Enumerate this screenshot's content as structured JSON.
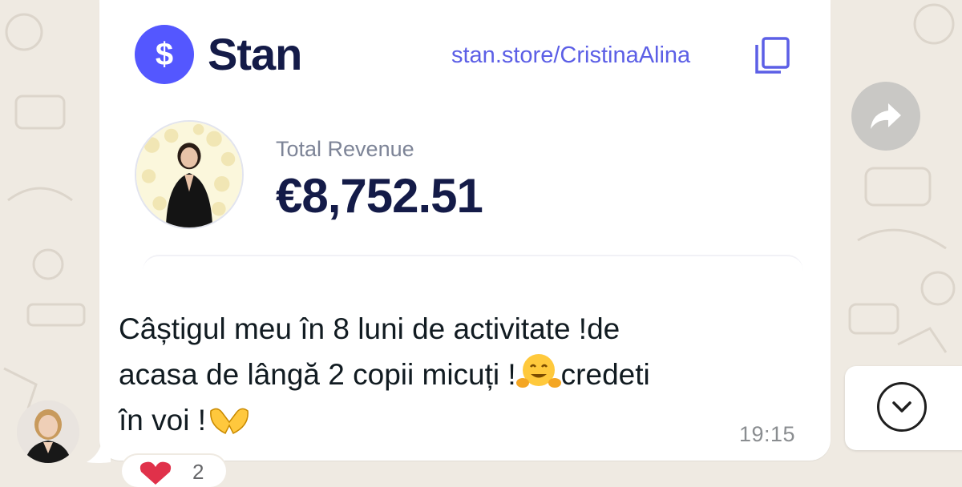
{
  "card": {
    "brand": "Stan",
    "logo_glyph": "$",
    "store_url": "stan.store/CristinaAlina",
    "revenue_label": "Total Revenue",
    "revenue_value": "€8,752.51"
  },
  "message": {
    "line1": "Câștigul meu în 8 luni de activitate !de",
    "line2_a": "acasa de lângă 2 copii micuți !",
    "line2_b": "credeti",
    "line3": "în voi !",
    "time": "19:15"
  },
  "reaction": {
    "count": "2"
  },
  "icons": {
    "logo": "dollar-icon",
    "copy": "copy-icon",
    "forward": "forward-arrow-icon",
    "scroll": "chevron-down-icon",
    "reaction": "heart-icon"
  },
  "colors": {
    "stan_accent": "#5457ff",
    "brand_text": "#141b48",
    "wallpaper": "#efeae2"
  }
}
